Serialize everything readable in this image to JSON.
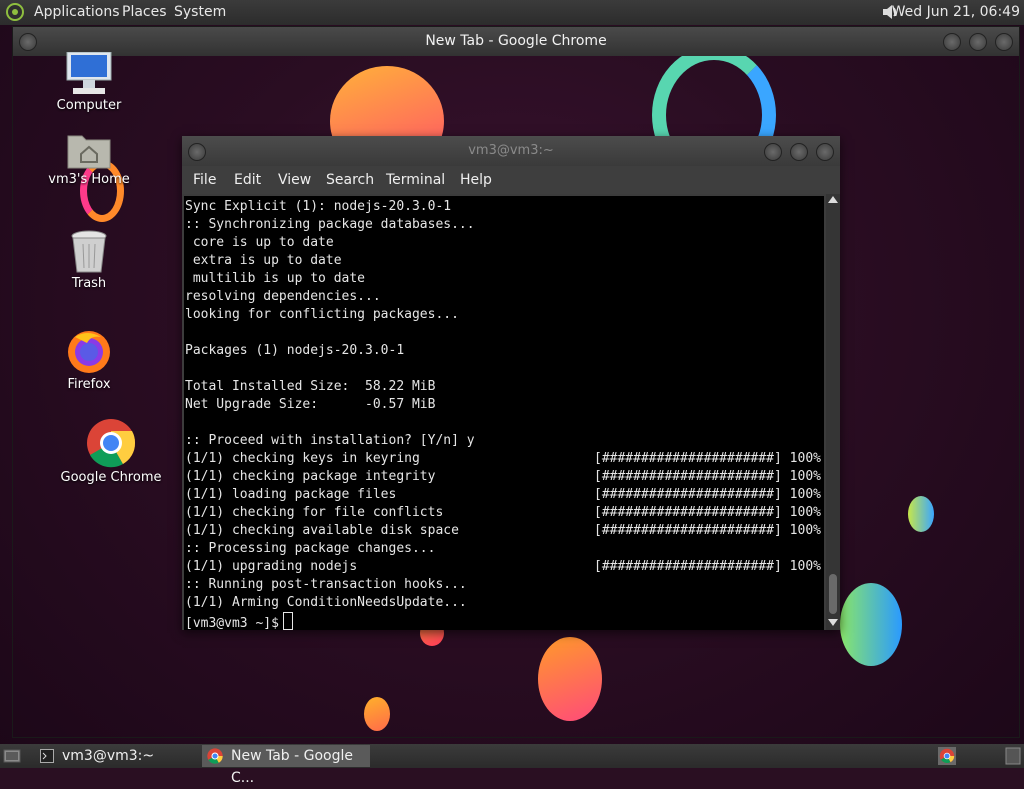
{
  "top_panel": {
    "menus": [
      "Applications",
      "Places",
      "System"
    ],
    "clock": "Wed Jun 21, 06:49"
  },
  "desktop_icons": [
    {
      "label": "Computer",
      "icon": "computer-icon"
    },
    {
      "label": "vm3's Home",
      "icon": "home-folder-icon"
    },
    {
      "label": "Trash",
      "icon": "trash-icon"
    },
    {
      "label": "Firefox",
      "icon": "firefox-icon"
    },
    {
      "label": "Google Chrome",
      "icon": "chrome-icon"
    }
  ],
  "chrome_window": {
    "title": "New Tab - Google Chrome"
  },
  "terminal": {
    "title": "vm3@vm3:~",
    "menu": [
      "File",
      "Edit",
      "View",
      "Search",
      "Terminal",
      "Help"
    ],
    "lines": [
      {
        "text": "Sync Explicit (1): nodejs-20.3.0-1",
        "bar": ""
      },
      {
        "text": ":: Synchronizing package databases...",
        "bar": ""
      },
      {
        "text": " core is up to date",
        "bar": ""
      },
      {
        "text": " extra is up to date",
        "bar": ""
      },
      {
        "text": " multilib is up to date",
        "bar": ""
      },
      {
        "text": "resolving dependencies...",
        "bar": ""
      },
      {
        "text": "looking for conflicting packages...",
        "bar": ""
      },
      {
        "text": "",
        "bar": ""
      },
      {
        "text": "Packages (1) nodejs-20.3.0-1",
        "bar": ""
      },
      {
        "text": "",
        "bar": ""
      },
      {
        "text": "Total Installed Size:  58.22 MiB",
        "bar": ""
      },
      {
        "text": "Net Upgrade Size:      -0.57 MiB",
        "bar": ""
      },
      {
        "text": "",
        "bar": ""
      },
      {
        "text": ":: Proceed with installation? [Y/n] y",
        "bar": ""
      },
      {
        "text": "(1/1) checking keys in keyring",
        "bar": "[######################] 100%"
      },
      {
        "text": "(1/1) checking package integrity",
        "bar": "[######################] 100%"
      },
      {
        "text": "(1/1) loading package files",
        "bar": "[######################] 100%"
      },
      {
        "text": "(1/1) checking for file conflicts",
        "bar": "[######################] 100%"
      },
      {
        "text": "(1/1) checking available disk space",
        "bar": "[######################] 100%"
      },
      {
        "text": ":: Processing package changes...",
        "bar": ""
      },
      {
        "text": "(1/1) upgrading nodejs",
        "bar": "[######################] 100%"
      },
      {
        "text": ":: Running post-transaction hooks...",
        "bar": ""
      },
      {
        "text": "(1/1) Arming ConditionNeedsUpdate...",
        "bar": ""
      }
    ],
    "prompt": "[vm3@vm3 ~]$"
  },
  "taskbar": {
    "tasks": [
      {
        "label": "vm3@vm3:~",
        "icon": "terminal-icon",
        "active": false
      },
      {
        "label": "New Tab - Google C...",
        "icon": "chrome-icon",
        "active": true
      }
    ]
  }
}
